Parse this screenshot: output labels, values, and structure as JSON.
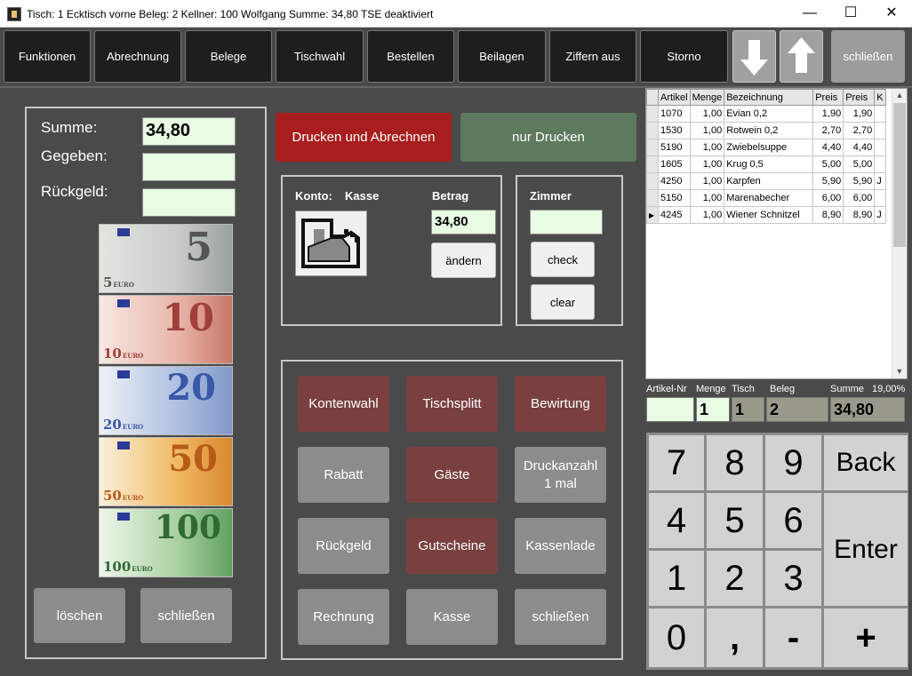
{
  "titlebar": {
    "text": "Tisch: 1 Ecktisch vorne  Beleg: 2  Kellner: 100 Wolfgang  Summe: 34,80  TSE deaktiviert",
    "minimize": "—",
    "maximize": "☐",
    "close": "✕"
  },
  "toolbar": {
    "buttons": [
      "Funktionen",
      "Abrechnung",
      "Belege",
      "Tischwahl",
      "Bestellen",
      "Beilagen",
      "Ziffern aus",
      "Storno"
    ],
    "close": "schließen"
  },
  "payment": {
    "summe_label": "Summe:",
    "summe_value": "34,80",
    "gegeben_label": "Gegeben:",
    "gegeben_value": "",
    "rueckgeld_label": "Rückgeld:",
    "rueckgeld_value": "",
    "delete": "löschen",
    "close": "schließen"
  },
  "notes": [
    {
      "value": "5",
      "small": "5",
      "euro": "EURO"
    },
    {
      "value": "10",
      "small": "10",
      "euro": "EURO"
    },
    {
      "value": "20",
      "small": "20",
      "euro": "EURO"
    },
    {
      "value": "50",
      "small": "50",
      "euro": "EURO"
    },
    {
      "value": "100",
      "small": "100",
      "euro": "EURO"
    }
  ],
  "colors": {
    "note5": "#c8ccc8",
    "note10": "#e8b4a8",
    "note20": "#aebfe0",
    "note50": "#f0b860",
    "note100": "#a8d0a0",
    "print_pay": "#a81e1e",
    "print_only": "#5e7a5e"
  },
  "actions": {
    "print_pay": "Drucken und Abrechnen",
    "print_only": "nur Drucken"
  },
  "konto": {
    "label": "Konto:",
    "name": "Kasse",
    "betrag_label": "Betrag",
    "betrag_value": "34,80",
    "change": "ändern"
  },
  "zimmer": {
    "label": "Zimmer",
    "value": "",
    "check": "check",
    "clear": "clear"
  },
  "functions": [
    {
      "label": "Kontenwahl",
      "style": "red"
    },
    {
      "label": "Tischsplitt",
      "style": "red"
    },
    {
      "label": "Bewirtung",
      "style": "red"
    },
    {
      "label": "Rabatt",
      "style": "gray"
    },
    {
      "label": "Gäste",
      "style": "red"
    },
    {
      "label": "Druckanzahl 1 mal",
      "style": "gray"
    },
    {
      "label": "Rückgeld",
      "style": "gray"
    },
    {
      "label": "Gutscheine",
      "style": "red"
    },
    {
      "label": "Kassenlade",
      "style": "gray"
    },
    {
      "label": "Rechnung",
      "style": "gray"
    },
    {
      "label": "Kasse",
      "style": "gray"
    },
    {
      "label": "schließen",
      "style": "gray"
    }
  ],
  "grid": {
    "headers": [
      "",
      "Artikel",
      "Menge",
      "Bezeichnung",
      "Preis",
      "Preis",
      "K"
    ],
    "rows": [
      {
        "sel": "",
        "artikel": "1070",
        "menge": "1,00",
        "bez": "Evian 0,2",
        "preis1": "1,90",
        "preis2": "1,90",
        "k": ""
      },
      {
        "sel": "",
        "artikel": "1530",
        "menge": "1,00",
        "bez": "Rotwein 0,2",
        "preis1": "2,70",
        "preis2": "2,70",
        "k": ""
      },
      {
        "sel": "",
        "artikel": "5190",
        "menge": "1,00",
        "bez": "Zwiebelsuppe",
        "preis1": "4,40",
        "preis2": "4,40",
        "k": ""
      },
      {
        "sel": "",
        "artikel": "1605",
        "menge": "1,00",
        "bez": "Krug 0,5",
        "preis1": "5,00",
        "preis2": "5,00",
        "k": ""
      },
      {
        "sel": "",
        "artikel": "4250",
        "menge": "1,00",
        "bez": "Karpfen",
        "preis1": "5,90",
        "preis2": "5,90",
        "k": "J"
      },
      {
        "sel": "",
        "artikel": "5150",
        "menge": "1,00",
        "bez": "Marenabecher",
        "preis1": "6,00",
        "preis2": "6,00",
        "k": ""
      },
      {
        "sel": "▶",
        "artikel": "4245",
        "menge": "1,00",
        "bez": "Wiener Schnitzel",
        "preis1": "8,90",
        "preis2": "8,90",
        "k": "J"
      }
    ]
  },
  "info": {
    "artikel_label": "Artikel-Nr",
    "menge_label": "Menge",
    "tisch_label": "Tisch",
    "beleg_label": "Beleg",
    "summe_label": "Summe",
    "vat_label": "19,00%",
    "artikel_value": "",
    "menge_value": "1",
    "tisch_value": "1",
    "beleg_value": "2",
    "summe_value": "34,80"
  },
  "keypad": {
    "k7": "7",
    "k8": "8",
    "k9": "9",
    "back": "Back",
    "k4": "4",
    "k5": "5",
    "k6": "6",
    "enter": "Enter",
    "k1": "1",
    "k2": "2",
    "k3": "3",
    "k0": "0",
    "comma": ",",
    "minus": "-",
    "plus": "+"
  }
}
